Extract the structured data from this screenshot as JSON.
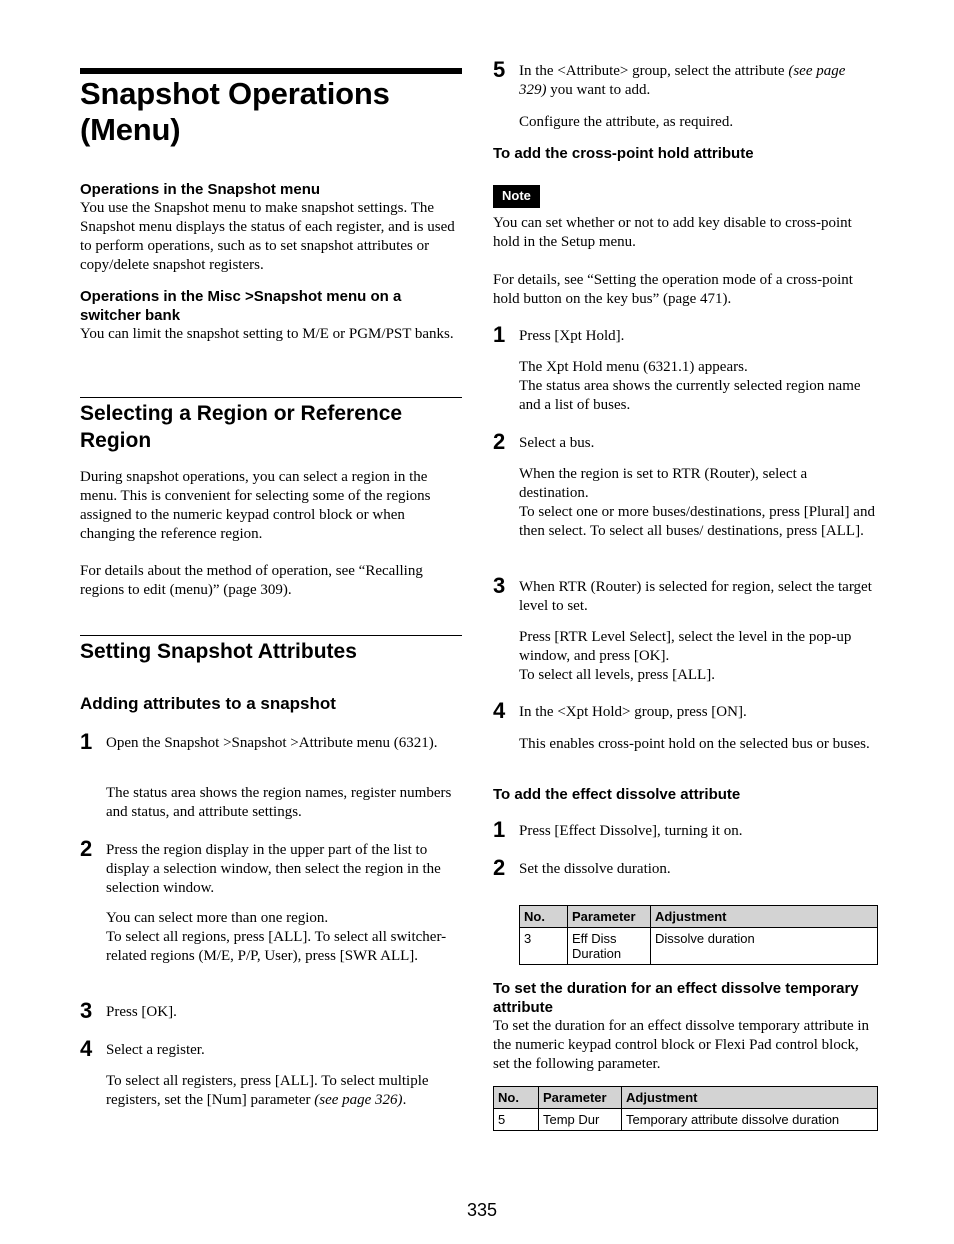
{
  "page": {
    "title": "Snapshot Operations (Menu)",
    "page_number": "335"
  },
  "left": {
    "ops_snapshot": {
      "heading": "Operations in the Snapshot menu",
      "body": "You use the Snapshot menu to make snapshot settings. The Snapshot menu displays the status of each register, and is used to perform operations, such as to set snapshot attributes or copy/delete snapshot registers."
    },
    "ops_misc": {
      "heading": "Operations in the Misc >Snapshot menu on a switcher bank",
      "body": "You can limit the snapshot setting to M/E or PGM/PST banks."
    },
    "selecting_region": {
      "heading": "Selecting a Region or Reference Region",
      "body": "During snapshot operations, you can select a region in the menu. This is convenient for selecting some of the regions assigned to the numeric keypad control block or when changing the reference region.",
      "ref": "For details about the method of operation, see “Recalling regions to edit (menu)” (page 309)."
    },
    "setting_attributes": {
      "heading": "Setting Snapshot Attributes",
      "subheading": "Adding attributes to a snapshot",
      "steps": [
        {
          "num": "1",
          "text": "Open the Snapshot >Snapshot >Attribute menu (6321).",
          "detail": "The status area shows the region names, register numbers and status, and attribute settings."
        },
        {
          "num": "2",
          "text": "Press the region display in the upper part of the list to display a selection window, then select the region in the selection window.",
          "detail": "You can select more than one region.\nTo select all regions, press [ALL]. To select all switcher-related regions (M/E, P/P, User), press [SWR ALL]."
        },
        {
          "num": "3",
          "text": "Press [OK]."
        },
        {
          "num": "4",
          "text": "Select a register.",
          "detail_pre": "To select all registers, press [ALL]. To select multiple registers, set the [Num] parameter ",
          "detail_ref": "(see page 326)",
          "detail_post": "."
        }
      ]
    }
  },
  "right": {
    "step5": {
      "num": "5",
      "text_pre": "In the <Attribute> group, select the attribute ",
      "text_ref": "(see page 329)",
      "text_post": " you want to add.",
      "detail": "Configure the attribute, as required."
    },
    "xpt_hold": {
      "heading": "To add the cross-point hold attribute",
      "note_label": "Note",
      "note_text": "You can set whether or not to add key disable to cross-point hold in the Setup menu.",
      "ref": "For details, see “Setting the operation mode of a cross-point hold button on the key bus” (page 471).",
      "steps": [
        {
          "num": "1",
          "text": "Press [Xpt Hold].",
          "detail": "The Xpt Hold menu (6321.1) appears.\nThe status area shows the currently selected region name and a list of buses."
        },
        {
          "num": "2",
          "text": "Select a bus.",
          "detail": "When the region is set to RTR (Router), select a destination.\nTo select one or more buses/destinations, press [Plural] and then select. To select all buses/ destinations, press [ALL]."
        },
        {
          "num": "3",
          "text": "When RTR (Router) is selected for region, select the target level to set.",
          "detail": "Press [RTR Level Select], select the level in the pop-up window, and press [OK].\nTo select all levels, press [ALL]."
        },
        {
          "num": "4",
          "text": "In the <Xpt Hold> group, press [ON].",
          "detail": "This enables cross-point hold on the selected bus or buses."
        }
      ]
    },
    "effect_dissolve": {
      "heading": "To add the effect dissolve attribute",
      "steps": [
        {
          "num": "1",
          "text": "Press [Effect Dissolve], turning it on."
        },
        {
          "num": "2",
          "text": "Set the dissolve duration."
        }
      ],
      "table": {
        "headers": [
          "No.",
          "Parameter",
          "Adjustment"
        ],
        "rows": [
          [
            "3",
            "Eff Diss Duration",
            "Dissolve duration"
          ]
        ]
      }
    },
    "temp_duration": {
      "heading": "To set the duration for an effect dissolve temporary attribute",
      "body": "To set the duration for an effect dissolve temporary attribute in the numeric keypad control block or Flexi Pad control block, set the following parameter.",
      "table": {
        "headers": [
          "No.",
          "Parameter",
          "Adjustment"
        ],
        "rows": [
          [
            "5",
            "Temp Dur",
            "Temporary attribute dissolve duration"
          ]
        ]
      }
    }
  }
}
